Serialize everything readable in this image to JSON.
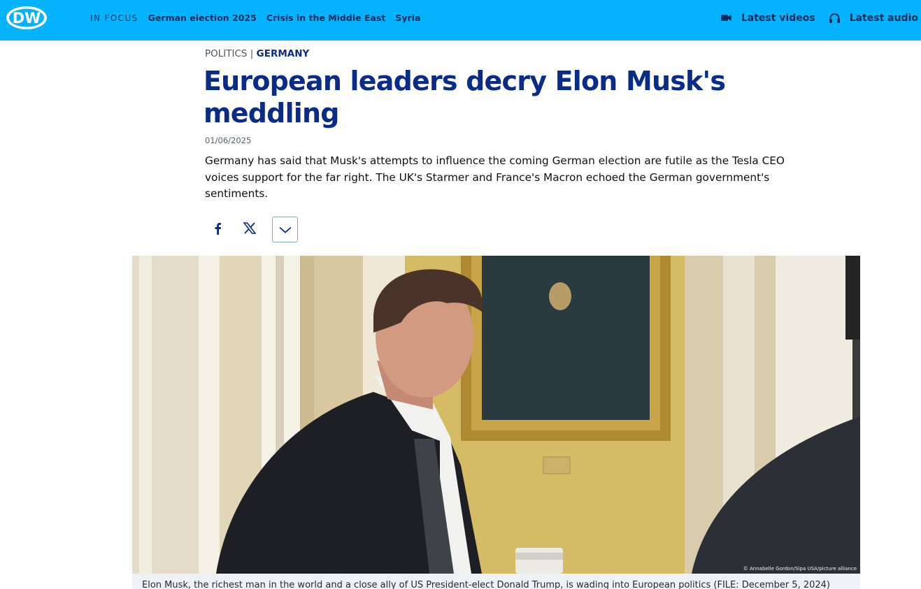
{
  "header": {
    "logo_text": "DW",
    "in_focus_label": "IN FOCUS",
    "focus_links": [
      "German election 2025",
      "Crisis in the Middle East",
      "Syria"
    ],
    "latest_videos": "Latest videos",
    "latest_audio": "Latest audio",
    "colors": {
      "bar": "#05b2fc",
      "nav_text": "#002d5c"
    }
  },
  "article": {
    "category": "POLITICS",
    "separator": "|",
    "subcategory": "GERMANY",
    "title": "European leaders decry Elon Musk's meddling",
    "date": "01/06/2025",
    "lead": "Germany has said that Musk's attempts to influence the coming German election are futile as the Tesla CEO voices support for the far right. The UK's Starmer and France's Macron echoed the German government's sentiments.",
    "share_icons": [
      "facebook-icon",
      "x-icon",
      "chevron-down-icon"
    ],
    "title_color": "#0a2c88"
  },
  "image": {
    "credit": "© Annabelle Gordon/Sipa USA/picture alliance",
    "caption": "Elon Musk, the richest man in the world and a close ally of US President-elect Donald Trump, is wading into European politics (FILE: December 5, 2024)"
  }
}
